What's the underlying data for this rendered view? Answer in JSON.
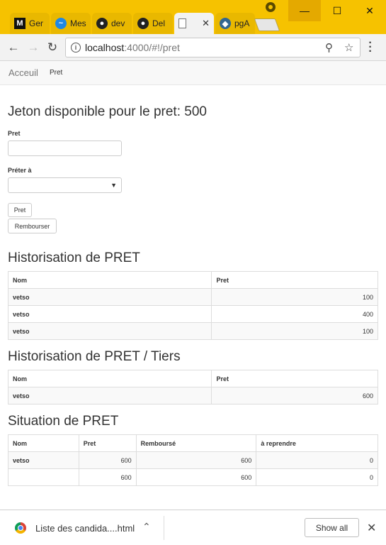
{
  "browser": {
    "tabs": [
      {
        "label": "Ger",
        "icon": "medium-icon"
      },
      {
        "label": "Mes",
        "icon": "messenger-icon"
      },
      {
        "label": "dev",
        "icon": "github-icon"
      },
      {
        "label": "Del",
        "icon": "github-icon"
      },
      {
        "label": "",
        "icon": "page-icon",
        "active": true
      },
      {
        "label": "pgA",
        "icon": "postgres-icon"
      }
    ],
    "url_host": "localhost",
    "url_path": ":4000/#!/pret",
    "close_tab_glyph": "✕"
  },
  "nav": {
    "brand": "Acceuil",
    "link": "Pret"
  },
  "page": {
    "heading": "Jeton disponible pour le pret: 500",
    "pret_label": "Pret",
    "pret_value": "",
    "preter_label": "Préter à",
    "preter_value": "",
    "pret_button": "Pret",
    "rembourser_button": "Rembourser"
  },
  "history": {
    "title": "Historisation de PRET",
    "headers": [
      "Nom",
      "Pret"
    ],
    "rows": [
      {
        "nom": "vetso",
        "pret": "100"
      },
      {
        "nom": "vetso",
        "pret": "400"
      },
      {
        "nom": "vetso",
        "pret": "100"
      }
    ]
  },
  "history_tiers": {
    "title": "Historisation de PRET / Tiers",
    "headers": [
      "Nom",
      "Pret"
    ],
    "rows": [
      {
        "nom": "vetso",
        "pret": "600"
      }
    ]
  },
  "situation": {
    "title": "Situation de PRET",
    "headers": [
      "Nom",
      "Pret",
      "Remboursé",
      "à reprendre"
    ],
    "rows": [
      {
        "nom": "vetso",
        "pret": "600",
        "rembourse": "600",
        "reprendre": "0"
      },
      {
        "nom": "",
        "pret": "600",
        "rembourse": "600",
        "reprendre": "0"
      }
    ]
  },
  "downloads": {
    "file": "Liste des candida....html",
    "show_all": "Show all"
  }
}
